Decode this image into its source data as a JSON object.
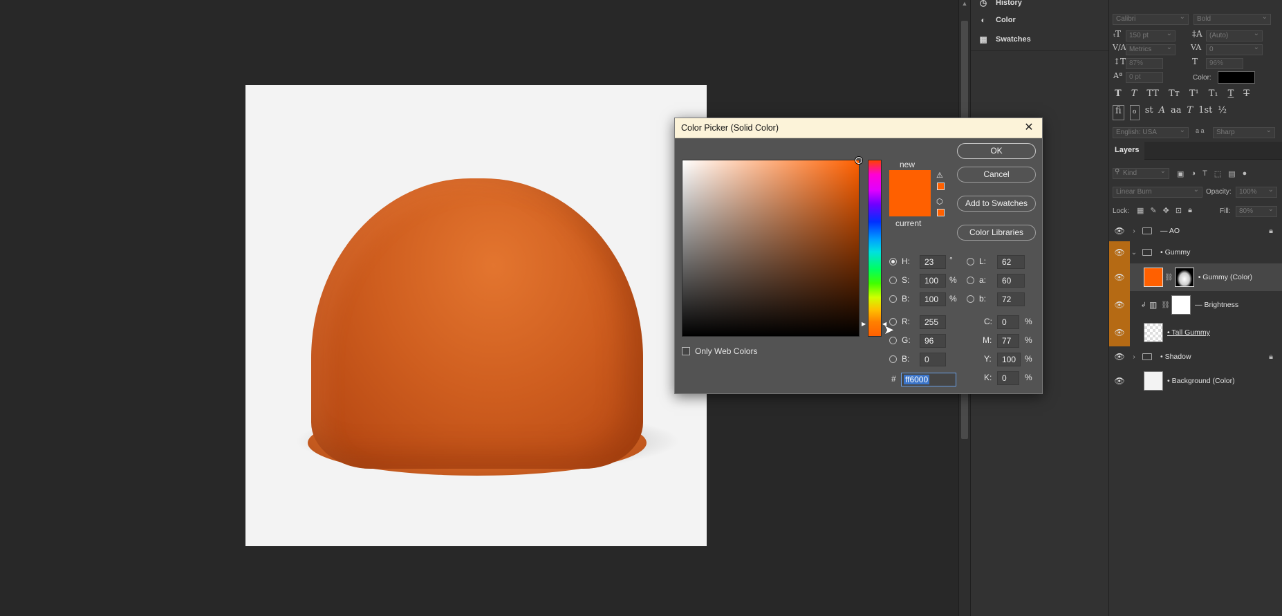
{
  "side_panel": {
    "items": [
      {
        "label": "History",
        "icon": "history-icon"
      },
      {
        "label": "Color",
        "icon": "color-icon"
      },
      {
        "label": "Swatches",
        "icon": "swatches-icon"
      }
    ]
  },
  "character": {
    "font_family": "Calibri",
    "font_style": "Bold",
    "size": "150 pt",
    "leading": "(Auto)",
    "kerning": "Metrics",
    "tracking": "0",
    "vscale": "87%",
    "hscale": "96%",
    "baseline": "0 pt",
    "color_label": "Color:",
    "color_value": "#000000",
    "language": "English: USA",
    "aa_label": "a a",
    "antialias": "Sharp",
    "style_glyphs": [
      "T",
      "T",
      "TT",
      "Tт",
      "T¹",
      "T₁",
      "T",
      "T"
    ],
    "ot_glyphs": [
      "fi",
      "ℴ",
      "st",
      "A",
      "aa",
      "T",
      "1st",
      "½"
    ]
  },
  "layers": {
    "tab": "Layers",
    "filter_kind": "Kind",
    "blend_mode": "Linear Burn",
    "opacity_label": "Opacity:",
    "opacity": "100%",
    "lock_label": "Lock:",
    "fill_label": "Fill:",
    "fill": "80%",
    "rows": [
      {
        "name": "— AO",
        "type": "group",
        "locked": true
      },
      {
        "name": "• Gummy",
        "type": "group-open",
        "locked": false
      },
      {
        "name": "• Gummy (Color)",
        "type": "fill",
        "selected": true
      },
      {
        "name": "— Brightness",
        "type": "adjustment"
      },
      {
        "name": "• Tall Gummy",
        "type": "smart"
      },
      {
        "name": "• Shadow",
        "type": "group",
        "locked": true
      },
      {
        "name": "• Background (Color)",
        "type": "fill"
      }
    ]
  },
  "dialog": {
    "title": "Color Picker (Solid Color)",
    "new_label": "new",
    "current_label": "current",
    "ok": "OK",
    "cancel": "Cancel",
    "add_swatches": "Add to Swatches",
    "color_libraries": "Color Libraries",
    "only_web": "Only Web Colors",
    "new_color": "#ff6000",
    "current_color": "#ff6000",
    "H": {
      "label": "H:",
      "value": "23",
      "unit": "°"
    },
    "S": {
      "label": "S:",
      "value": "100",
      "unit": "%"
    },
    "Bv": {
      "label": "B:",
      "value": "100",
      "unit": "%"
    },
    "R": {
      "label": "R:",
      "value": "255"
    },
    "G": {
      "label": "G:",
      "value": "96"
    },
    "Bb": {
      "label": "B:",
      "value": "0"
    },
    "L": {
      "label": "L:",
      "value": "62"
    },
    "a": {
      "label": "a:",
      "value": "60"
    },
    "b": {
      "label": "b:",
      "value": "72"
    },
    "C": {
      "label": "C:",
      "value": "0",
      "unit": "%"
    },
    "M": {
      "label": "M:",
      "value": "77",
      "unit": "%"
    },
    "Y": {
      "label": "Y:",
      "value": "100",
      "unit": "%"
    },
    "K": {
      "label": "K:",
      "value": "0",
      "unit": "%"
    },
    "hash": "#",
    "hex": "ff6000"
  }
}
